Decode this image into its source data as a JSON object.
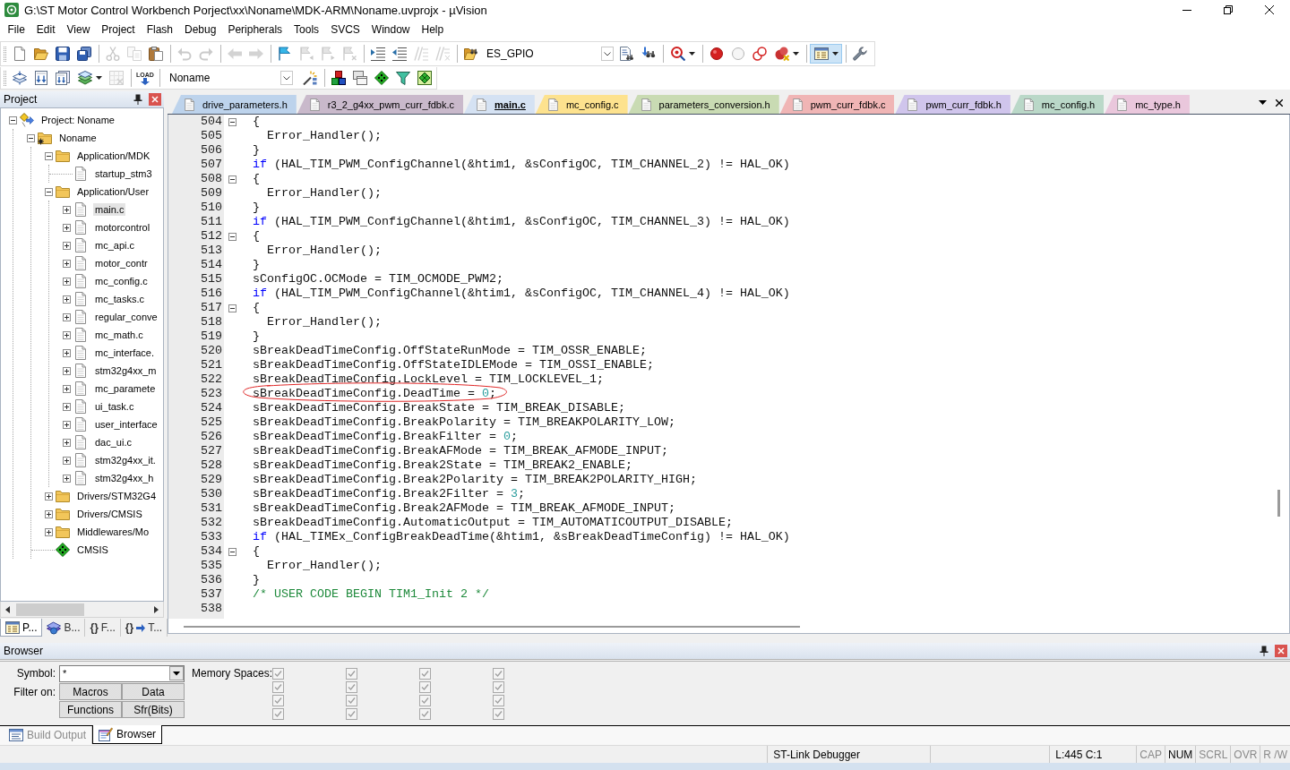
{
  "window": {
    "title": "G:\\ST Motor Control Workbench Porject\\xx\\Noname\\MDK-ARM\\Noname.uvprojx - µVision"
  },
  "menu": [
    "File",
    "Edit",
    "View",
    "Project",
    "Flash",
    "Debug",
    "Peripherals",
    "Tools",
    "SVCS",
    "Window",
    "Help"
  ],
  "toolbar_1": [
    {
      "kind": "new",
      "disabled": false
    },
    {
      "kind": "open",
      "disabled": false
    },
    {
      "kind": "save",
      "disabled": false
    },
    {
      "kind": "saveall",
      "disabled": false
    },
    {
      "kind": "separator"
    },
    {
      "kind": "cut",
      "disabled": true
    },
    {
      "kind": "copy",
      "disabled": true
    },
    {
      "kind": "paste",
      "disabled": false
    },
    {
      "kind": "separator"
    },
    {
      "kind": "undo",
      "disabled": true
    },
    {
      "kind": "redo",
      "disabled": true
    },
    {
      "kind": "separator"
    },
    {
      "kind": "back",
      "disabled": true
    },
    {
      "kind": "forward",
      "disabled": true
    },
    {
      "kind": "separator"
    },
    {
      "kind": "bookmark",
      "disabled": false
    },
    {
      "kind": "bookprev",
      "disabled": true
    },
    {
      "kind": "booknext",
      "disabled": true
    },
    {
      "kind": "bookclear",
      "disabled": true
    },
    {
      "kind": "separator"
    },
    {
      "kind": "indent",
      "disabled": false
    },
    {
      "kind": "unindent",
      "disabled": false
    },
    {
      "kind": "comment",
      "disabled": true
    },
    {
      "kind": "uncomment",
      "disabled": true
    },
    {
      "kind": "separator"
    },
    {
      "kind": "findfiles",
      "disabled": false
    },
    {
      "kind": "combo",
      "value": "ES_GPIO"
    },
    {
      "kind": "finddoc",
      "disabled": false
    },
    {
      "kind": "binoculars",
      "disabled": false
    },
    {
      "kind": "separator"
    },
    {
      "kind": "debug",
      "disabled": false,
      "dropdown": true
    },
    {
      "kind": "separator"
    },
    {
      "kind": "breakpoint",
      "disabled": false
    },
    {
      "kind": "bpempty",
      "disabled": false
    },
    {
      "kind": "bpdisable",
      "disabled": false
    },
    {
      "kind": "bpkill",
      "disabled": false,
      "dropdown": true
    },
    {
      "kind": "separator"
    },
    {
      "kind": "window",
      "disabled": false,
      "dropdown": true,
      "pressed": true
    },
    {
      "kind": "separator"
    },
    {
      "kind": "wrench",
      "disabled": false
    }
  ],
  "toolbar_2": [
    {
      "kind": "translate",
      "disabled": false
    },
    {
      "kind": "build",
      "disabled": false
    },
    {
      "kind": "rebuild",
      "disabled": false
    },
    {
      "kind": "batch",
      "disabled": false,
      "dropdown": true
    },
    {
      "kind": "stopbuild",
      "disabled": true
    },
    {
      "kind": "separator"
    },
    {
      "kind": "load",
      "label": "LOAD",
      "disabled": false
    },
    {
      "kind": "separator"
    },
    {
      "kind": "combo",
      "value": "Noname"
    },
    {
      "kind": "wand",
      "disabled": false
    },
    {
      "kind": "separator"
    },
    {
      "kind": "components",
      "disabled": false
    },
    {
      "kind": "projectitems",
      "disabled": false
    },
    {
      "kind": "diamond",
      "disabled": false
    },
    {
      "kind": "funnel",
      "disabled": false
    },
    {
      "kind": "grid",
      "disabled": false
    }
  ],
  "project_panel": {
    "title": "Project",
    "tree": [
      {
        "label": "Project: Noname",
        "kind": "project",
        "expanded": true,
        "selected": false,
        "children": [
          {
            "label": "Noname",
            "kind": "target",
            "expanded": true,
            "selected": false,
            "children": [
              {
                "label": "Application/MDK",
                "kind": "folder",
                "expanded": true,
                "selected": false,
                "children": [
                  {
                    "label": "startup_stm3",
                    "kind": "file",
                    "selected": false
                  }
                ]
              },
              {
                "label": "Application/User",
                "kind": "folder",
                "expanded": true,
                "selected": false,
                "children": [
                  {
                    "label": "main.c",
                    "kind": "file",
                    "expanded": false,
                    "selected": true
                  },
                  {
                    "label": "motorcontrol",
                    "kind": "file",
                    "expanded": false,
                    "selected": false
                  },
                  {
                    "label": "mc_api.c",
                    "kind": "file",
                    "expanded": false,
                    "selected": false
                  },
                  {
                    "label": "motor_contr",
                    "kind": "file",
                    "expanded": false,
                    "selected": false
                  },
                  {
                    "label": "mc_config.c",
                    "kind": "file",
                    "expanded": false,
                    "selected": false
                  },
                  {
                    "label": "mc_tasks.c",
                    "kind": "file",
                    "expanded": false,
                    "selected": false
                  },
                  {
                    "label": "regular_conve",
                    "kind": "file",
                    "expanded": false,
                    "selected": false
                  },
                  {
                    "label": "mc_math.c",
                    "kind": "file",
                    "expanded": false,
                    "selected": false
                  },
                  {
                    "label": "mc_interface.",
                    "kind": "file",
                    "expanded": false,
                    "selected": false
                  },
                  {
                    "label": "stm32g4xx_m",
                    "kind": "file",
                    "expanded": false,
                    "selected": false
                  },
                  {
                    "label": "mc_paramete",
                    "kind": "file",
                    "expanded": false,
                    "selected": false
                  },
                  {
                    "label": "ui_task.c",
                    "kind": "file",
                    "expanded": false,
                    "selected": false
                  },
                  {
                    "label": "user_interface",
                    "kind": "file",
                    "expanded": false,
                    "selected": false
                  },
                  {
                    "label": "dac_ui.c",
                    "kind": "file",
                    "expanded": false,
                    "selected": false
                  },
                  {
                    "label": "stm32g4xx_it.",
                    "kind": "file",
                    "expanded": false,
                    "selected": false
                  },
                  {
                    "label": "stm32g4xx_h",
                    "kind": "file",
                    "expanded": false,
                    "selected": false
                  }
                ]
              },
              {
                "label": "Drivers/STM32G4",
                "kind": "folder",
                "expanded": false,
                "selected": false
              },
              {
                "label": "Drivers/CMSIS",
                "kind": "folder",
                "expanded": false,
                "selected": false
              },
              {
                "label": "Middlewares/Mo",
                "kind": "folder",
                "expanded": false,
                "selected": false
              },
              {
                "label": "CMSIS",
                "kind": "component",
                "selected": false
              }
            ]
          }
        ]
      }
    ],
    "tabs": [
      {
        "kind": "project",
        "label": "P...",
        "selected": true
      },
      {
        "kind": "books",
        "label": "B...",
        "selected": false
      },
      {
        "kind": "functions",
        "glyph": "{}",
        "label": "F...",
        "selected": false
      },
      {
        "kind": "templates",
        "glyph": "{}",
        "label": "T...",
        "selected": false
      }
    ]
  },
  "editor": {
    "tabs": [
      {
        "label": "drive_parameters.h",
        "color": "#bdd3ec",
        "selected": false
      },
      {
        "label": "r3_2_g4xx_pwm_curr_fdbk.c",
        "color": "#c9b9cb",
        "selected": false
      },
      {
        "label": "main.c",
        "color": "#d5e2f3",
        "selected": true
      },
      {
        "label": "mc_config.c",
        "color": "#fde28e",
        "selected": false
      },
      {
        "label": "parameters_conversion.h",
        "color": "#c9dbb3",
        "selected": false
      },
      {
        "label": "pwm_curr_fdbk.c",
        "color": "#f0b5b5",
        "selected": false
      },
      {
        "label": "pwm_curr_fdbk.h",
        "color": "#d0c5ec",
        "selected": false
      },
      {
        "label": "mc_config.h",
        "color": "#bad8c8",
        "selected": false
      },
      {
        "label": "mc_type.h",
        "color": "#eac7dc",
        "selected": false
      }
    ],
    "lines": [
      {
        "number": "504",
        "fold": true,
        "segments": [
          {
            "kind": "plain",
            "text": "{"
          }
        ]
      },
      {
        "number": "505",
        "fold": false,
        "segments": [
          {
            "kind": "plain",
            "text": "  Error_Handler();"
          }
        ]
      },
      {
        "number": "506",
        "fold": false,
        "segments": [
          {
            "kind": "plain",
            "text": "}"
          }
        ]
      },
      {
        "number": "507",
        "fold": false,
        "segments": [
          {
            "kind": "keyword",
            "text": "if"
          },
          {
            "kind": "plain",
            "text": " (HAL_TIM_PWM_ConfigChannel(&htim1, &sConfigOC, TIM_CHANNEL_2) != HAL_OK)"
          }
        ]
      },
      {
        "number": "508",
        "fold": true,
        "segments": [
          {
            "kind": "plain",
            "text": "{"
          }
        ]
      },
      {
        "number": "509",
        "fold": false,
        "segments": [
          {
            "kind": "plain",
            "text": "  Error_Handler();"
          }
        ]
      },
      {
        "number": "510",
        "fold": false,
        "segments": [
          {
            "kind": "plain",
            "text": "}"
          }
        ]
      },
      {
        "number": "511",
        "fold": false,
        "segments": [
          {
            "kind": "keyword",
            "text": "if"
          },
          {
            "kind": "plain",
            "text": " (HAL_TIM_PWM_ConfigChannel(&htim1, &sConfigOC, TIM_CHANNEL_3) != HAL_OK)"
          }
        ]
      },
      {
        "number": "512",
        "fold": true,
        "segments": [
          {
            "kind": "plain",
            "text": "{"
          }
        ]
      },
      {
        "number": "513",
        "fold": false,
        "segments": [
          {
            "kind": "plain",
            "text": "  Error_Handler();"
          }
        ]
      },
      {
        "number": "514",
        "fold": false,
        "segments": [
          {
            "kind": "plain",
            "text": "}"
          }
        ]
      },
      {
        "number": "515",
        "fold": false,
        "segments": [
          {
            "kind": "plain",
            "text": "sConfigOC.OCMode = TIM_OCMODE_PWM2;"
          }
        ]
      },
      {
        "number": "516",
        "fold": false,
        "segments": [
          {
            "kind": "keyword",
            "text": "if"
          },
          {
            "kind": "plain",
            "text": " (HAL_TIM_PWM_ConfigChannel(&htim1, &sConfigOC, TIM_CHANNEL_4) != HAL_OK)"
          }
        ]
      },
      {
        "number": "517",
        "fold": true,
        "segments": [
          {
            "kind": "plain",
            "text": "{"
          }
        ]
      },
      {
        "number": "518",
        "fold": false,
        "segments": [
          {
            "kind": "plain",
            "text": "  Error_Handler();"
          }
        ]
      },
      {
        "number": "519",
        "fold": false,
        "segments": [
          {
            "kind": "plain",
            "text": "}"
          }
        ]
      },
      {
        "number": "520",
        "fold": false,
        "segments": [
          {
            "kind": "plain",
            "text": "sBreakDeadTimeConfig.OffStateRunMode = TIM_OSSR_ENABLE;"
          }
        ]
      },
      {
        "number": "521",
        "fold": false,
        "segments": [
          {
            "kind": "plain",
            "text": "sBreakDeadTimeConfig.OffStateIDLEMode = TIM_OSSI_ENABLE;"
          }
        ]
      },
      {
        "number": "522",
        "fold": false,
        "segments": [
          {
            "kind": "plain",
            "text": "sBreakDeadTimeConfig.LockLevel = TIM_LOCKLEVEL_1;"
          }
        ]
      },
      {
        "number": "523",
        "fold": false,
        "circled": true,
        "segments": [
          {
            "kind": "plain",
            "text": "sBreakDeadTimeConfig.DeadTime = "
          },
          {
            "kind": "number",
            "text": "0"
          },
          {
            "kind": "plain",
            "text": ";"
          }
        ]
      },
      {
        "number": "524",
        "fold": false,
        "segments": [
          {
            "kind": "plain",
            "text": "sBreakDeadTimeConfig.BreakState = TIM_BREAK_DISABLE;"
          }
        ]
      },
      {
        "number": "525",
        "fold": false,
        "segments": [
          {
            "kind": "plain",
            "text": "sBreakDeadTimeConfig.BreakPolarity = TIM_BREAKPOLARITY_LOW;"
          }
        ]
      },
      {
        "number": "526",
        "fold": false,
        "segments": [
          {
            "kind": "plain",
            "text": "sBreakDeadTimeConfig.BreakFilter = "
          },
          {
            "kind": "number",
            "text": "0"
          },
          {
            "kind": "plain",
            "text": ";"
          }
        ]
      },
      {
        "number": "527",
        "fold": false,
        "segments": [
          {
            "kind": "plain",
            "text": "sBreakDeadTimeConfig.BreakAFMode = TIM_BREAK_AFMODE_INPUT;"
          }
        ]
      },
      {
        "number": "528",
        "fold": false,
        "segments": [
          {
            "kind": "plain",
            "text": "sBreakDeadTimeConfig.Break2State = TIM_BREAK2_ENABLE;"
          }
        ]
      },
      {
        "number": "529",
        "fold": false,
        "segments": [
          {
            "kind": "plain",
            "text": "sBreakDeadTimeConfig.Break2Polarity = TIM_BREAK2POLARITY_HIGH;"
          }
        ]
      },
      {
        "number": "530",
        "fold": false,
        "segments": [
          {
            "kind": "plain",
            "text": "sBreakDeadTimeConfig.Break2Filter = "
          },
          {
            "kind": "number",
            "text": "3"
          },
          {
            "kind": "plain",
            "text": ";"
          }
        ]
      },
      {
        "number": "531",
        "fold": false,
        "segments": [
          {
            "kind": "plain",
            "text": "sBreakDeadTimeConfig.Break2AFMode = TIM_BREAK_AFMODE_INPUT;"
          }
        ]
      },
      {
        "number": "532",
        "fold": false,
        "segments": [
          {
            "kind": "plain",
            "text": "sBreakDeadTimeConfig.AutomaticOutput = TIM_AUTOMATICOUTPUT_DISABLE;"
          }
        ]
      },
      {
        "number": "533",
        "fold": false,
        "segments": [
          {
            "kind": "keyword",
            "text": "if"
          },
          {
            "kind": "plain",
            "text": " (HAL_TIMEx_ConfigBreakDeadTime(&htim1, &sBreakDeadTimeConfig) != HAL_OK)"
          }
        ]
      },
      {
        "number": "534",
        "fold": true,
        "segments": [
          {
            "kind": "plain",
            "text": "{"
          }
        ]
      },
      {
        "number": "535",
        "fold": false,
        "segments": [
          {
            "kind": "plain",
            "text": "  Error_Handler();"
          }
        ]
      },
      {
        "number": "536",
        "fold": false,
        "segments": [
          {
            "kind": "plain",
            "text": "}"
          }
        ]
      },
      {
        "number": "537",
        "fold": false,
        "segments": [
          {
            "kind": "comment",
            "text": "/* USER CODE BEGIN TIM1_Init 2 */"
          }
        ]
      },
      {
        "number": "538",
        "fold": false
      }
    ]
  },
  "browser": {
    "title": "Browser",
    "symbol_label": "Symbol:",
    "symbol_value": "*",
    "filter_label": "Filter on:",
    "filter_buttons": [
      "Macros",
      "Data",
      "Functions",
      "Sfr(Bits)"
    ],
    "memory_label": "Memory Spaces:",
    "memory_checkboxes": [
      {
        "checked": true,
        "disabled": true
      },
      {
        "checked": true,
        "disabled": true
      },
      {
        "checked": true,
        "disabled": true
      },
      {
        "checked": true,
        "disabled": true
      },
      {
        "checked": true,
        "disabled": true
      },
      {
        "checked": true,
        "disabled": true
      },
      {
        "checked": true,
        "disabled": true
      },
      {
        "checked": true,
        "disabled": true
      },
      {
        "checked": true,
        "disabled": true
      },
      {
        "checked": true,
        "disabled": true
      },
      {
        "checked": true,
        "disabled": true
      },
      {
        "checked": true,
        "disabled": true
      },
      {
        "checked": true,
        "disabled": true
      },
      {
        "checked": true,
        "disabled": true
      },
      {
        "checked": true,
        "disabled": true
      },
      {
        "checked": true,
        "disabled": true
      }
    ],
    "tabs": [
      {
        "kind": "output",
        "label": "Build Output",
        "selected": false
      },
      {
        "kind": "browser",
        "label": "Browser",
        "selected": true
      }
    ]
  },
  "status_bar": {
    "debugger": "ST-Link Debugger",
    "position": "L:445 C:1",
    "indicators": [
      {
        "label": "CAP",
        "on": false
      },
      {
        "label": "NUM",
        "on": true
      },
      {
        "label": "SCRL",
        "on": false
      },
      {
        "label": "OVR",
        "on": false
      },
      {
        "label": "R /W",
        "on": false
      }
    ]
  }
}
